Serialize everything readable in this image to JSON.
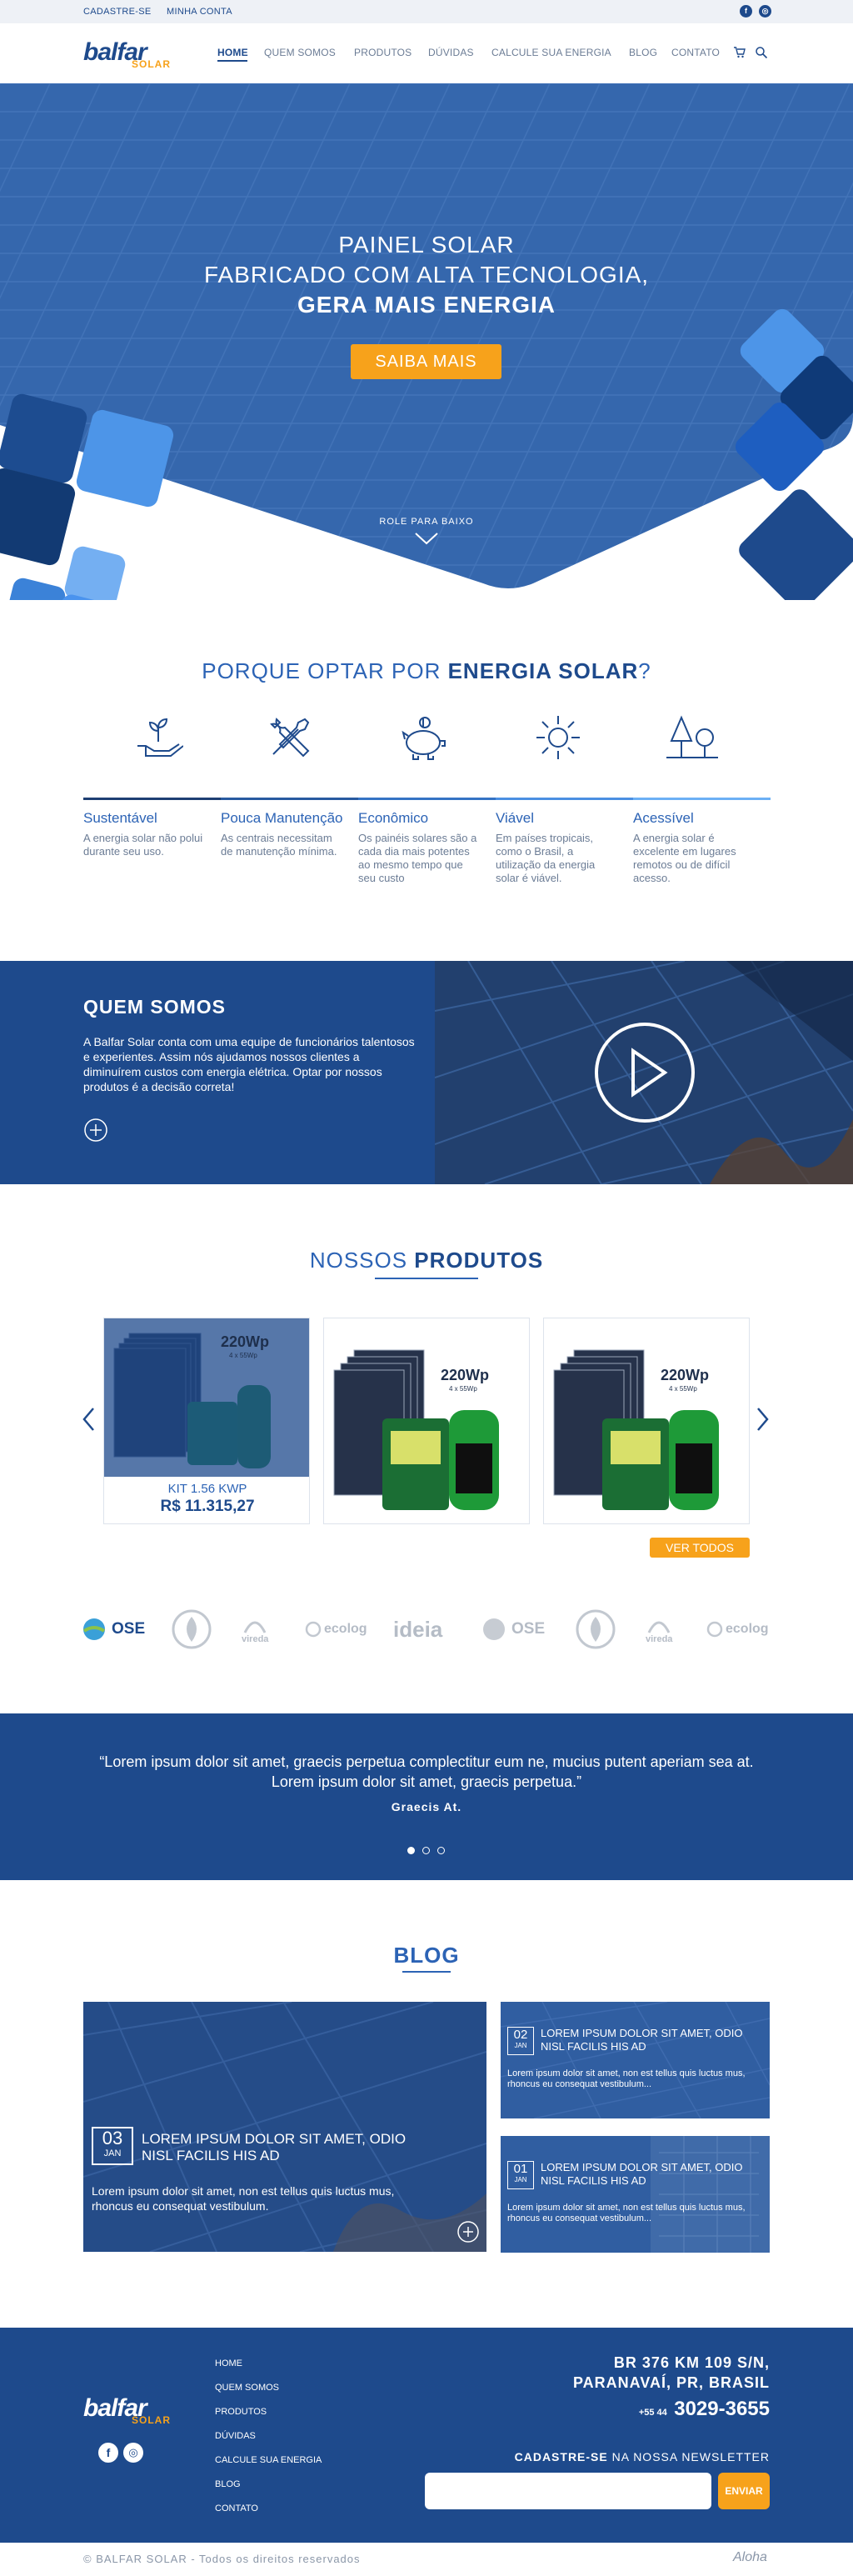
{
  "topbar": {
    "register": "CADASTRE-SE",
    "account": "MINHA CONTA",
    "facebook_icon": "facebook-icon",
    "instagram_icon": "instagram-icon"
  },
  "brand": {
    "name": "balfar",
    "sub": "SOLAR"
  },
  "nav": {
    "items": [
      "HOME",
      "QUEM SOMOS",
      "PRODUTOS",
      "DÚVIDAS",
      "CALCULE SUA ENERGIA",
      "BLOG",
      "CONTATO"
    ],
    "cart_icon": "cart-icon",
    "search_icon": "search-icon"
  },
  "hero": {
    "line1": "PAINEL SOLAR",
    "line2": "FABRICADO COM ALTA TECNOLOGIA,",
    "line3": "GERA MAIS ENERGIA",
    "cta": "SAIBA MAIS",
    "scroll": "ROLE PARA BAIXO"
  },
  "why": {
    "title_a": "PORQUE OPTAR POR ",
    "title_b": "ENERGIA SOLAR",
    "title_c": "?"
  },
  "features": [
    {
      "title": "Sustentável",
      "desc": "A energia solar não polui durante seu uso.",
      "icon": "plant-hand-icon"
    },
    {
      "title": "Pouca Manutenção",
      "desc": "As centrais necessitam de manutenção mínima.",
      "icon": "tools-icon"
    },
    {
      "title": "Econômico",
      "desc": "Os painéis solares são a cada dia mais potentes ao mesmo tempo que seu custo",
      "icon": "piggy-bank-icon"
    },
    {
      "title": "Viável",
      "desc": "Em países tropicais, como o Brasil, a utilização da energia solar é viável.",
      "icon": "sun-icon"
    },
    {
      "title": "Acessível",
      "desc": "A energia solar é excelente em lugares remotos ou de difícil acesso.",
      "icon": "trees-icon"
    }
  ],
  "about": {
    "title": "QUEM SOMOS",
    "text": "A Balfar Solar conta com uma equipe de funcionários talentosos e experientes. Assim nós ajudamos nossos clientes a diminuírem custos com energia elétrica. Optar por nossos produtos é a decisão correta!"
  },
  "products": {
    "title_a": "NOSSOS ",
    "title_b": "PRODUTOS",
    "items": [
      {
        "watt": "220Wp",
        "sub": "4 x 55Wp",
        "name": "KIT 1.56 KWP",
        "price": "R$ 11.315,27"
      },
      {
        "watt": "220Wp",
        "sub": "4 x 55Wp"
      },
      {
        "watt": "220Wp",
        "sub": "4 x 55Wp"
      }
    ],
    "see_all": "VER TODOS"
  },
  "partners": [
    "OSE",
    "",
    "vireda",
    "ecolog",
    "ideia",
    "OSE",
    "",
    "vireda",
    "ecolog"
  ],
  "testimonial": {
    "quote": "“Lorem ipsum dolor sit amet, graecis perpetua complectitur eum ne, mucius putent aperiam sea at. Lorem ipsum dolor sit amet, graecis perpetua.”",
    "author": "Graecis At."
  },
  "blog": {
    "title": "BLOG",
    "main": {
      "day": "03",
      "month": "JAN",
      "title": "LOREM IPSUM DOLOR SIT AMET, ODIO NISL FACILIS HIS AD",
      "text": "Lorem ipsum dolor sit amet, non est tellus quis luctus mus, rhoncus eu consequat vestibulum."
    },
    "side": [
      {
        "day": "02",
        "month": "JAN",
        "title": "LOREM IPSUM DOLOR SIT AMET, ODIO NISL FACILIS HIS AD",
        "text": "Lorem ipsum dolor sit amet, non est tellus quis luctus mus, rhoncus eu consequat vestibulum..."
      },
      {
        "day": "01",
        "month": "JAN",
        "title": "LOREM IPSUM DOLOR SIT AMET, ODIO NISL FACILIS HIS AD",
        "text": "Lorem ipsum dolor sit amet, non est tellus quis luctus mus, rhoncus eu consequat vestibulum..."
      }
    ]
  },
  "footer": {
    "links": [
      "HOME",
      "QUEM SOMOS",
      "PRODUTOS",
      "DÚVIDAS",
      "CALCULE SUA ENERGIA",
      "BLOG",
      "CONTATO"
    ],
    "address1": "BR 376 KM 109 S/N,",
    "address2": "PARANAVAÍ, PR,  BRASIL",
    "phone_prefix": "+55 44",
    "phone": "3029-3655",
    "newsletter_a": "CADASTRE-SE",
    "newsletter_b": " NA NOSSA NEWSLETTER",
    "send": "ENVIAR",
    "copyright": "© BALFAR SOLAR - Todos os direitos reservados",
    "credit": "Aloha"
  },
  "colors": {
    "primary": "#1e4a8c",
    "accent": "#f7a21b",
    "light": "#2c63b5"
  }
}
